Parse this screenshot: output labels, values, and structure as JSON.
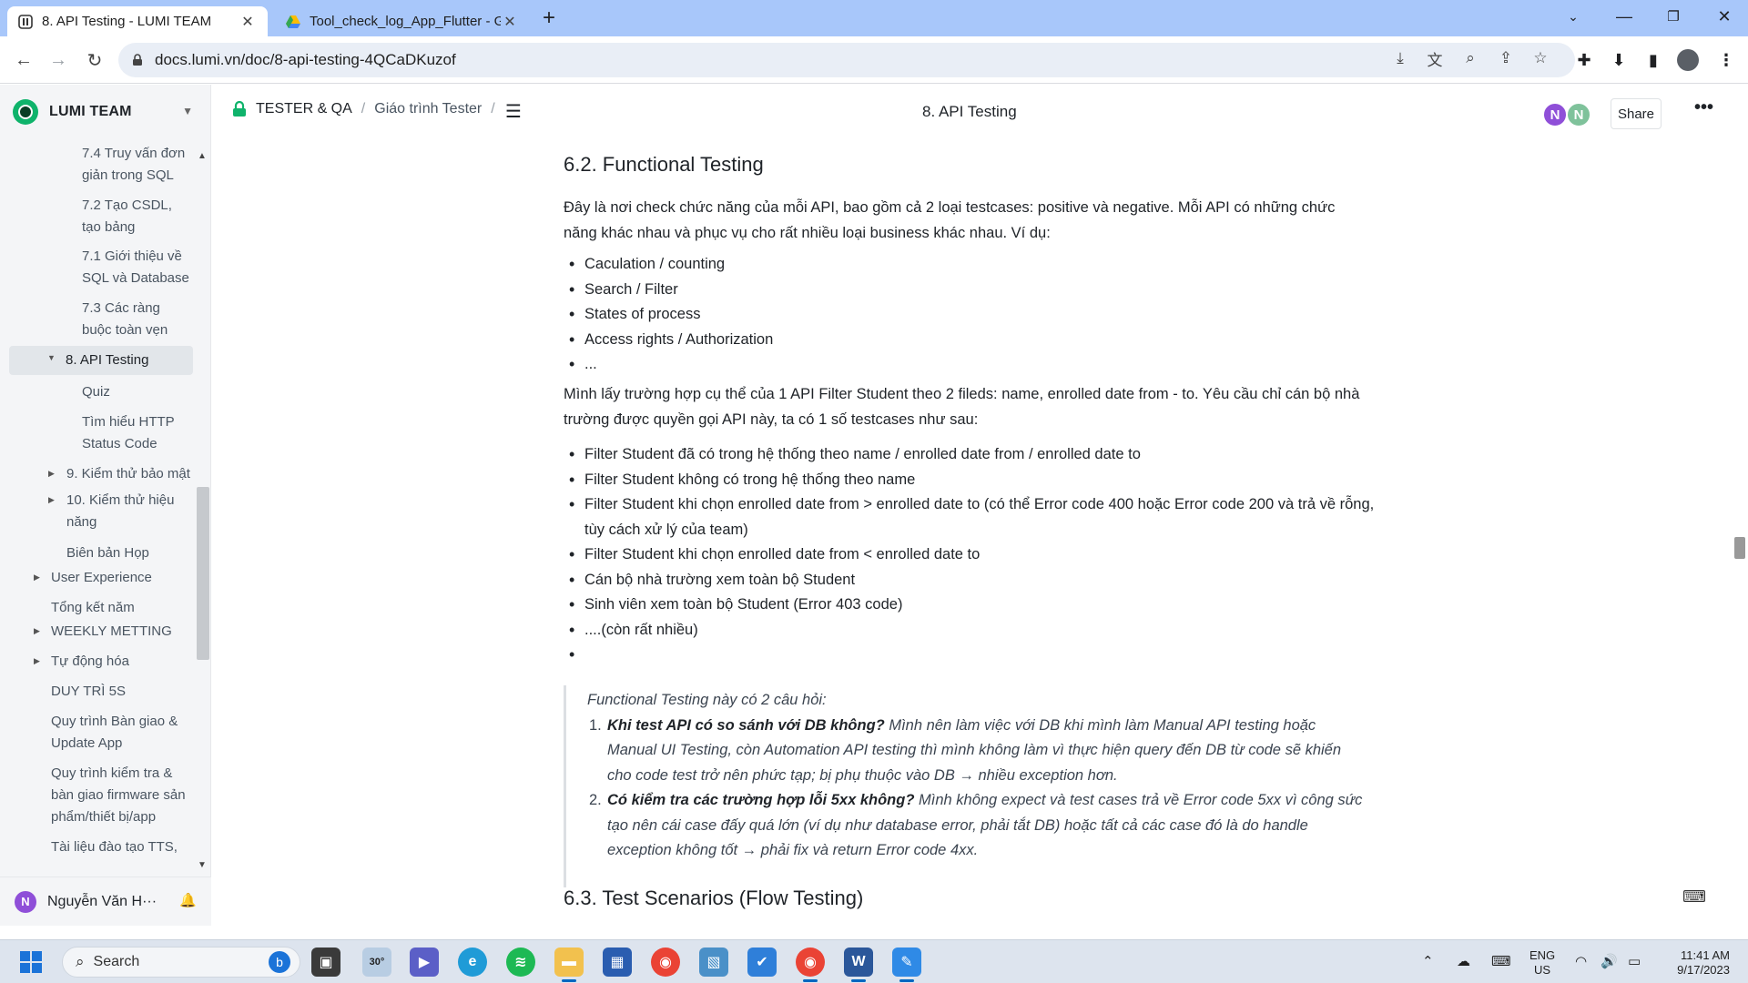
{
  "browser": {
    "tabs": [
      {
        "title": "8. API Testing - LUMI TEAM",
        "active": true
      },
      {
        "title": "Tool_check_log_App_Flutter - Go",
        "active": false
      }
    ],
    "new_tab": "+",
    "url": "docs.lumi.vn/doc/8-api-testing-4QCaDKuzof"
  },
  "sidebar": {
    "team_name": "LUMI TEAM",
    "items": [
      {
        "label": "7.4 Truy vấn đơn giản trong SQL",
        "level": 3
      },
      {
        "label": "7.2 Tạo CSDL, tạo bảng",
        "level": 3
      },
      {
        "label": "7.1 Giới thiệu về SQL và Database",
        "level": 3
      },
      {
        "label": "7.3 Các ràng buộc toàn vẹn",
        "level": 3
      },
      {
        "label": "8. API Testing",
        "level": 2,
        "active": true,
        "caret": "down"
      },
      {
        "label": "Quiz",
        "level": 3
      },
      {
        "label": "Tìm hiểu HTTP Status Code",
        "level": 3
      },
      {
        "label": "9. Kiểm thử bảo mật",
        "level": 2,
        "caret": "right"
      },
      {
        "label": "10. Kiểm thử hiệu năng",
        "level": 2,
        "caret": "right"
      },
      {
        "label": "Biên bản Họp",
        "level": 2
      },
      {
        "label": "User Experience",
        "level": 1,
        "caret": "right"
      },
      {
        "label": "Tổng kết năm",
        "level": 1
      },
      {
        "label": "WEEKLY METTING",
        "level": 1,
        "caret": "right"
      },
      {
        "label": "Tự động hóa",
        "level": 1,
        "caret": "right"
      },
      {
        "label": "DUY TRÌ 5S",
        "level": 1
      },
      {
        "label": "Quy trình Bàn giao & Update App",
        "level": 1
      },
      {
        "label": "Quy trình kiểm tra & bàn giao firmware sản phẩm/thiết bị/app",
        "level": 1
      },
      {
        "label": "Tài liệu đào tạo TTS,",
        "level": 1
      }
    ],
    "user_initial": "N",
    "user_name": "Nguyễn Văn H···"
  },
  "header": {
    "breadcrumb": [
      "TESTER & QA",
      "Giáo trình Tester"
    ],
    "separator": "/",
    "doc_title": "8. API Testing",
    "avatars": [
      {
        "initial": "N",
        "color": "#8f4fd8"
      },
      {
        "initial": "N",
        "color": "#7fc29b"
      }
    ],
    "share_label": "Share"
  },
  "doc": {
    "h_functional": "6.2. Functional Testing",
    "p_intro": "Đây là nơi check chức năng của mỗi API, bao gồm cả 2 loại testcases: positive và negative. Mỗi API có những chức năng khác nhau và phục vụ cho rất nhiều loại business khác nhau. Ví dụ:",
    "examples": [
      "Caculation / counting",
      "Search / Filter",
      "States of process",
      "Access rights / Authorization",
      "..."
    ],
    "p_case": "Mình lấy trường hợp cụ thể của 1 API Filter Student theo 2 fileds: name, enrolled date from - to. Yêu cầu chỉ cán bộ nhà trường được quyền gọi API này, ta có 1 số testcases như sau:",
    "testcases": [
      "Filter Student đã có trong hệ thống theo name / enrolled date from / enrolled date to",
      "Filter Student không có trong hệ thống theo name",
      "Filter Student khi chọn enrolled date from > enrolled date to (có thể Error code 400 hoặc Error code 200 và trả về rỗng, tùy cách xử lý của team)",
      "Filter Student khi chọn enrolled date from < enrolled date to",
      "Cán bộ nhà trường xem toàn bộ Student",
      "Sinh viên xem toàn bộ Student (Error 403 code)",
      "....(còn rất nhiều)",
      ""
    ],
    "quote": {
      "intro": "Functional Testing này có 2 câu hỏi:",
      "items": [
        {
          "num": "1.",
          "q": "Khi test API có so sánh với DB không?",
          "a": " Mình nên làm việc với DB khi mình làm Manual API testing hoặc Manual UI Testing, còn Automation API testing thì mình không làm vì thực hiện query đến DB từ code sẽ khiến cho code test trở nên phức tạp; bị phụ thuộc vào DB → nhiều exception hơn."
        },
        {
          "num": "2.",
          "q": "Có kiểm tra các trường hợp lỗi 5xx không?",
          "a": " Mình không expect và test cases trả về Error code 5xx vì công sức tạo nên cái case đấy quá lớn (ví dụ như database error, phải tắt DB) hoặc tất cả các case đó là do handle exception không tốt → phải fix và return Error code 4xx."
        }
      ]
    },
    "h_scenarios": "6.3. Test Scenarios (Flow Testing)"
  },
  "taskbar": {
    "search_label": "Search",
    "weather": "30°",
    "lang_line1": "ENG",
    "lang_line2": "US",
    "time": "11:41 AM",
    "date": "9/17/2023"
  }
}
